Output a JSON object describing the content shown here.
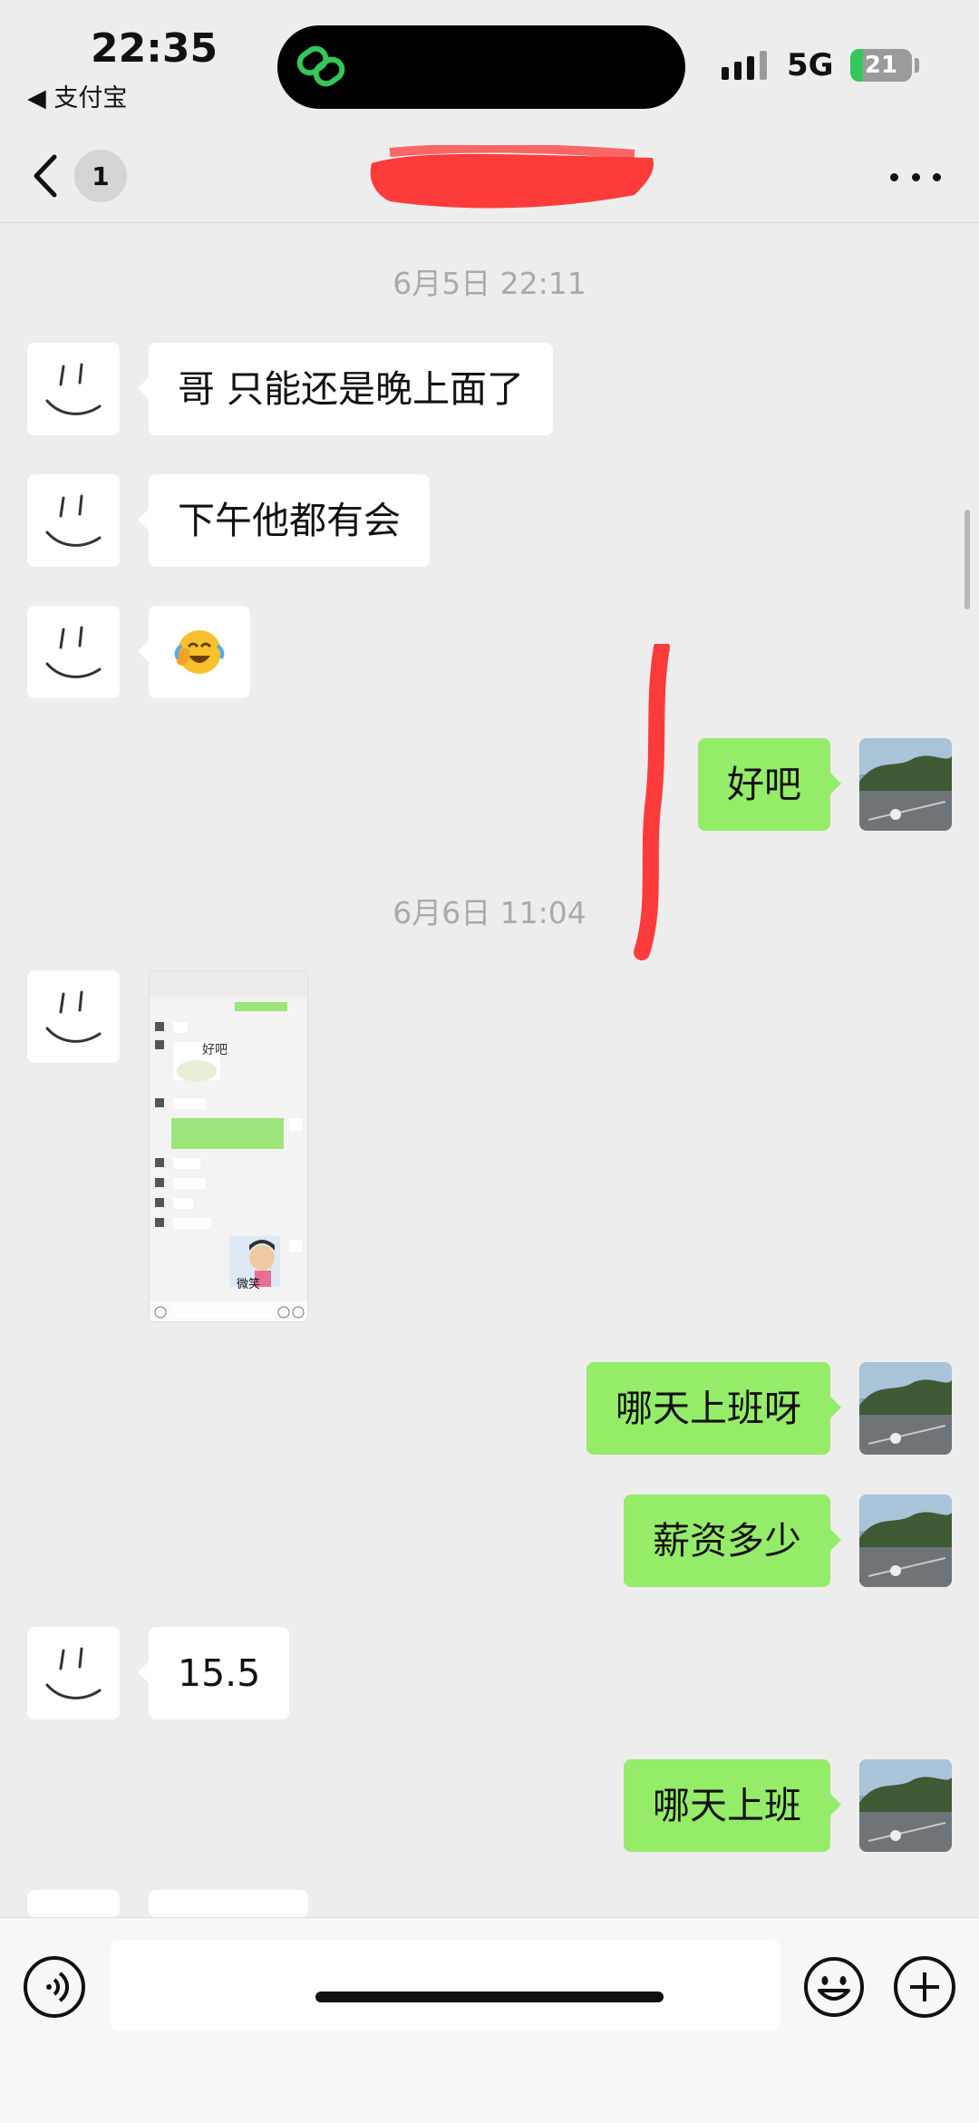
{
  "status_bar": {
    "time": "22:35",
    "back_app_label": "◀ 支付宝",
    "network": "5G",
    "battery_level": "21",
    "battery_charging": true
  },
  "nav": {
    "unread_count": "1",
    "title_redacted": true
  },
  "messages": [
    {
      "type": "timestamp",
      "text": "6月5日 22:11"
    },
    {
      "type": "text",
      "side": "incoming",
      "text": "哥 只能还是晚上面了"
    },
    {
      "type": "text",
      "side": "incoming",
      "text": "下午他都有会"
    },
    {
      "type": "emoji",
      "side": "incoming",
      "icon": "face-with-tears-of-joy-emoji"
    },
    {
      "type": "text",
      "side": "outgoing",
      "text": "好吧"
    },
    {
      "type": "timestamp",
      "text": "6月6日 11:04"
    },
    {
      "type": "image",
      "side": "incoming",
      "content": "chat screenshot thumbnail"
    },
    {
      "type": "text",
      "side": "outgoing",
      "text": "哪天上班呀"
    },
    {
      "type": "text",
      "side": "outgoing",
      "text": "薪资多少"
    },
    {
      "type": "text",
      "side": "incoming",
      "text": "15.5"
    },
    {
      "type": "text",
      "side": "outgoing",
      "text": "哪天上班"
    }
  ],
  "thumbnail": {
    "sticker_text_1": "好吧",
    "sticker_text_2": "微笑"
  },
  "colors": {
    "background": "#ededed",
    "outgoing_bubble": "#95ec69",
    "incoming_bubble": "#ffffff",
    "redaction": "#ff2b2b"
  }
}
